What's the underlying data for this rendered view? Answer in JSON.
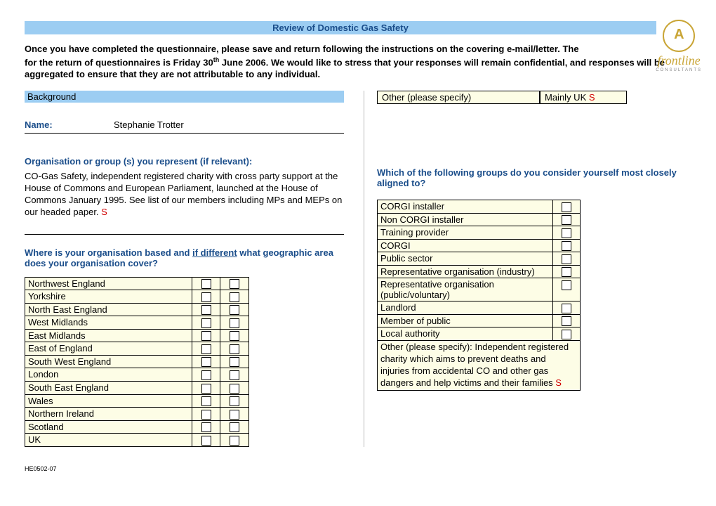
{
  "logo": {
    "name": "frontline",
    "sub": "CONSULTANTS"
  },
  "title": "Review of Domestic Gas Safety",
  "intro_a": "Once you have completed the questionnaire, please save and return following the instructions on the covering e-mail/letter. The",
  "intro_b": "for the return of questionnaires is Friday 30",
  "intro_b_sup": "th",
  "intro_b_after": " June 2006.  We would like to stress that your responses will remain confidential, and responses will be aggregated to ensure that they are not attributable to any individual.",
  "bg_label": "Background",
  "name_label": "Name:",
  "name_value": "Stephanie Trotter",
  "org_q": "Organisation or group (s) you represent (if relevant):",
  "org_a": "CO-Gas Safety, independent registered charity with cross party support at the House of Commons and European Parliament, launched at the House of Commons January 1995. See list of our members including MPs and MEPs on our headed paper.  ",
  "org_a_s": "S",
  "geo_q_a": "Where is your organisation based and ",
  "geo_q_u": "if different",
  "geo_q_b": " what geographic area does your organisation cover?",
  "regions": [
    "Northwest England",
    "Yorkshire",
    "North East England",
    "West Midlands",
    "East Midlands",
    "East of England",
    "South West England",
    "London",
    "South East England",
    "Wales",
    "Northern Ireland",
    "Scotland",
    "UK"
  ],
  "other_spec": "Other (please specify)",
  "other_val_a": "Mainly UK  ",
  "other_val_s": "S",
  "align_q": "Which of the following groups do you consider yourself most closely aligned to?",
  "groups": [
    "CORGI installer",
    "Non CORGI installer",
    "Training provider",
    "CORGI",
    "Public sector",
    "Representative organisation (industry)",
    "Representative organisation (public/voluntary)",
    "Landlord",
    "Member of public",
    "Local authority"
  ],
  "groups_other": "Other (please specify): Independent registered charity which aims to prevent deaths and injuries from accidental CO and other gas dangers and help victims and their families ",
  "groups_other_s": "S",
  "footer": "HE0502-07"
}
